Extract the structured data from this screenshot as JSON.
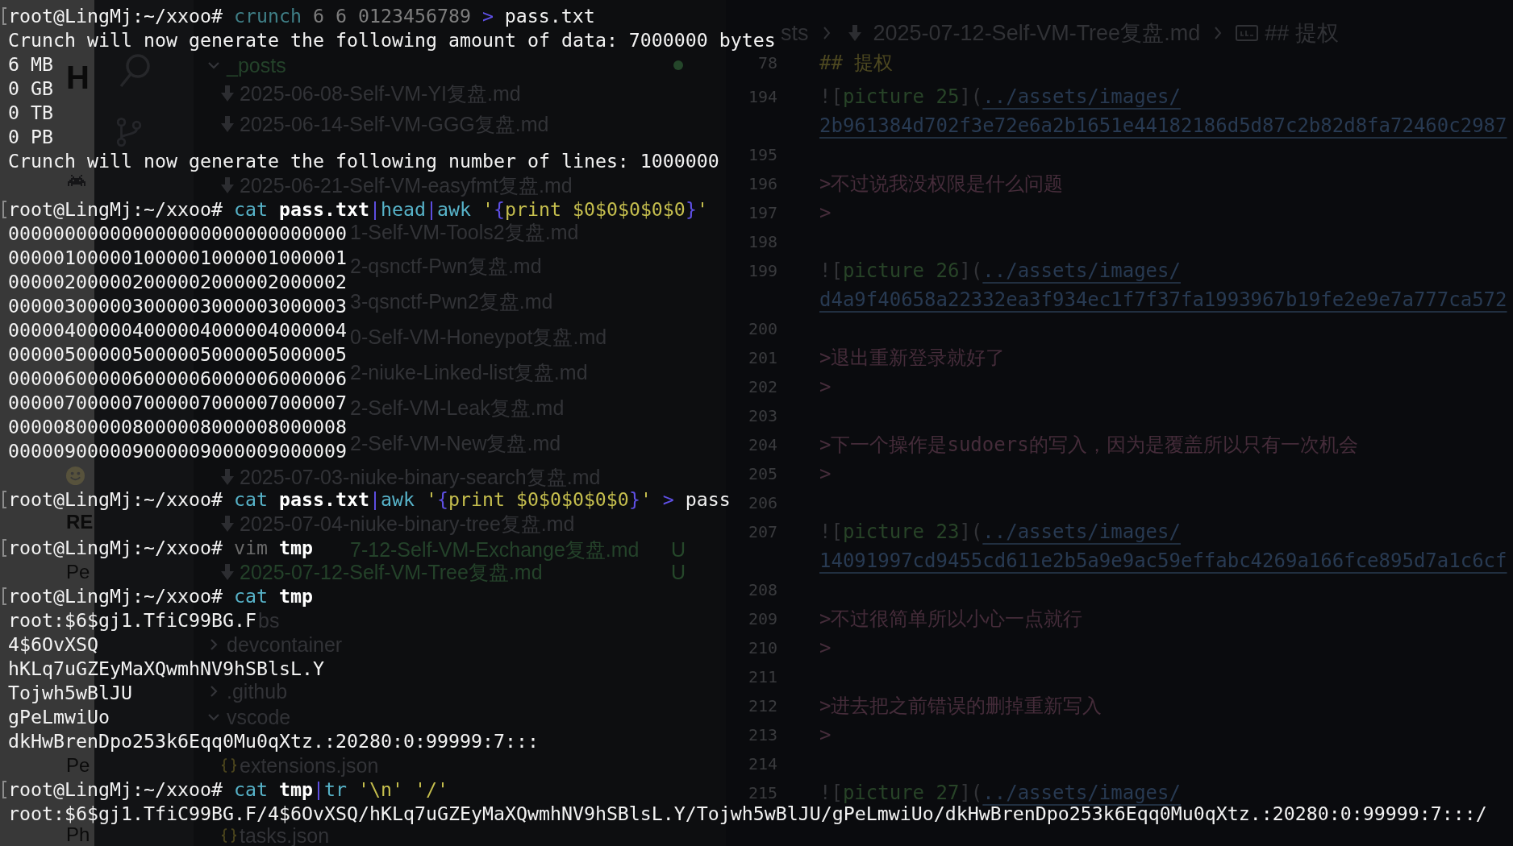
{
  "terminal": {
    "blocks": [
      {
        "prompt": "root@LingMj:~/xxoo#",
        "command": [
          [
            {
              "text": "crunch",
              "kind": "faded"
            }
          ],
          [
            {
              "text": "6",
              "kind": "argument"
            }
          ],
          [
            {
              "text": "6",
              "kind": "argument"
            }
          ],
          [
            {
              "text": "0123456789",
              "kind": "argument"
            }
          ],
          [
            {
              "text": ">",
              "kind": "operator"
            }
          ],
          [
            {
              "text": "pass.txt",
              "kind": "plain"
            }
          ]
        ],
        "output": [
          "Crunch will now generate the following amount of data: 7000000 bytes",
          "6 MB",
          "0 GB",
          "0 TB",
          "0 PB",
          "Crunch will now generate the following number of lines: 1000000"
        ]
      },
      {
        "prompt": "root@LingMj:~/xxoo#",
        "command": [
          [
            {
              "text": "cat",
              "kind": "command"
            }
          ],
          [
            {
              "text": "pass.txt",
              "kind": "file"
            },
            {
              "text": "|",
              "kind": "operator"
            },
            {
              "text": "head",
              "kind": "command"
            },
            {
              "text": "|",
              "kind": "operator"
            },
            {
              "text": "awk",
              "kind": "command"
            }
          ],
          [
            {
              "text": "'",
              "kind": "string"
            },
            {
              "text": "{",
              "kind": "operator"
            },
            {
              "text": "print",
              "kind": "string"
            }
          ],
          [
            {
              "text": "$0$0$0$0$0",
              "kind": "string"
            },
            {
              "text": "}",
              "kind": "operator"
            },
            {
              "text": "'",
              "kind": "string"
            }
          ]
        ],
        "output": [
          "000000000000000000000000000000",
          "000001000001000001000001000001",
          "000002000002000002000002000002",
          "000003000003000003000003000003",
          "000004000004000004000004000004",
          "000005000005000005000005000005",
          "000006000006000006000006000006",
          "000007000007000007000007000007",
          "000008000008000008000008000008",
          "000009000009000009000009000009"
        ]
      },
      {
        "prompt": "root@LingMj:~/xxoo#",
        "command": [
          [
            {
              "text": "cat",
              "kind": "command"
            }
          ],
          [
            {
              "text": "pass.txt",
              "kind": "file"
            },
            {
              "text": "|",
              "kind": "operator"
            },
            {
              "text": "awk",
              "kind": "command"
            }
          ],
          [
            {
              "text": "'",
              "kind": "string"
            },
            {
              "text": "{",
              "kind": "operator"
            },
            {
              "text": "print",
              "kind": "string"
            }
          ],
          [
            {
              "text": "$0$0$0$0$0",
              "kind": "string"
            },
            {
              "text": "}",
              "kind": "operator"
            },
            {
              "text": "'",
              "kind": "string"
            }
          ],
          [
            {
              "text": ">",
              "kind": "operator"
            }
          ],
          [
            {
              "text": "pass",
              "kind": "plain"
            }
          ]
        ]
      },
      {
        "prompt": "root@LingMj:~/xxoo#",
        "command": [
          [
            {
              "text": "vim",
              "kind": "unknown"
            }
          ],
          [
            {
              "text": "tmp",
              "kind": "file"
            }
          ]
        ]
      },
      {
        "prompt": "root@LingMj:~/xxoo#",
        "command": [
          [
            {
              "text": "cat",
              "kind": "command"
            }
          ],
          [
            {
              "text": "tmp",
              "kind": "file"
            }
          ]
        ],
        "output": [
          "root:$6$gj1.TfiC99BG.F",
          "4$6OvXSQ",
          "hKLq7uGZEyMaXQwmhNV9hSBlsL.Y",
          "Tojwh5wBlJU",
          "gPeLmwiUo",
          "dkHwBrenDpo253k6Eqq0Mu0qXtz.:20280:0:99999:7:::"
        ]
      },
      {
        "prompt": "root@LingMj:~/xxoo#",
        "command": [
          [
            {
              "text": "cat",
              "kind": "command"
            }
          ],
          [
            {
              "text": "tmp",
              "kind": "file"
            },
            {
              "text": "|",
              "kind": "operator"
            },
            {
              "text": "tr",
              "kind": "command"
            }
          ],
          [
            {
              "text": "'\\n'",
              "kind": "string"
            }
          ],
          [
            {
              "text": "'/'",
              "kind": "string"
            }
          ]
        ],
        "output": [
          "root:$6$gj1.TfiC99BG.F/4$6OvXSQ/hKLq7uGZEyMaXQwmhNV9hSBlsL.Y/Tojwh5wBlJU/gPeLmwiUo/dkHwBrenDpo253k6Eqq0Mu0qXtz.:20280:0:99999:7:::/"
        ]
      }
    ]
  },
  "background": {
    "side_window": {
      "texts": [
        {
          "text": "H",
          "kind": "title"
        },
        {
          "text": "RE",
          "kind": "heading"
        },
        {
          "text": "Pe",
          "kind": "text"
        },
        {
          "text": "Pe",
          "kind": "text"
        },
        {
          "text": "Ph",
          "kind": "text"
        }
      ]
    },
    "explorer": {
      "tree": [
        {
          "name": "_posts",
          "kind": "folder",
          "expanded": true,
          "modified": true,
          "children": [
            {
              "name": "2025-06-08-Self-VM-YI复盘.md",
              "kind": "markdown"
            },
            {
              "name": "2025-06-14-Self-VM-GGG复盘.md",
              "kind": "markdown"
            },
            {
              "name": "2025-06-21-Self-VM-easyfmt复盘.md",
              "kind": "markdown"
            },
            {
              "name": "1-Self-VM-Tools2复盘.md",
              "kind": "markdown_clipped"
            },
            {
              "name": "2-qsnctf-Pwn复盘.md",
              "kind": "markdown_clipped"
            },
            {
              "name": "3-qsnctf-Pwn2复盘.md",
              "kind": "markdown_clipped"
            },
            {
              "name": "0-Self-VM-Honeypot复盘.md",
              "kind": "markdown_clipped"
            },
            {
              "name": "2-niuke-Linked-list复盘.md",
              "kind": "markdown_clipped"
            },
            {
              "name": "2-Self-VM-Leak复盘.md",
              "kind": "markdown_clipped"
            },
            {
              "name": "2-Self-VM-New复盘.md",
              "kind": "markdown_clipped"
            },
            {
              "name": "2025-07-03-niuke-binary-search复盘.md",
              "kind": "markdown"
            },
            {
              "name": "2025-07-04-niuke-binary-tree复盘.md",
              "kind": "markdown"
            },
            {
              "name": "7-12-Self-VM-Exchange复盘.md",
              "kind": "markdown_clipped",
              "status": "U"
            },
            {
              "name": "2025-07-12-Self-VM-Tree复盘.md",
              "kind": "markdown",
              "status": "U"
            }
          ]
        },
        {
          "name": "bs",
          "kind": "folder_clipped"
        },
        {
          "name": "devcontainer",
          "kind": "folder",
          "expanded": false
        },
        {
          "name": ".github",
          "kind": "folder",
          "expanded": false
        },
        {
          "name": "vscode",
          "kind": "folder",
          "expanded": true,
          "children": [
            {
              "name": "extensions.json",
              "kind": "json"
            },
            {
              "name": "tasks.json",
              "kind": "json"
            }
          ]
        }
      ]
    },
    "editor": {
      "breadcrumb": [
        {
          "text": "sts",
          "kind": "folder"
        },
        {
          "text": "2025-07-12-Self-VM-Tree复盘.md",
          "kind": "markdown"
        },
        {
          "text": "## 提权",
          "kind": "symbol"
        }
      ],
      "sticky_line": {
        "number": "78",
        "segments": [
          {
            "text": "## 提权",
            "kind": "heading"
          }
        ]
      },
      "lines": [
        {
          "number": "194",
          "segments": [
            {
              "text": "![",
              "kind": "punct"
            },
            {
              "text": "picture 25",
              "kind": "alt"
            },
            {
              "text": "](",
              "kind": "punct"
            },
            {
              "text": "../assets/images/",
              "kind": "link"
            }
          ]
        },
        {
          "segments": [
            {
              "text": "2b961384d702f3e72e6a2b1651e44182186d5d87c2b82d8fa72460c2987",
              "kind": "link"
            }
          ]
        },
        {
          "number": "195"
        },
        {
          "number": "196",
          "segments": [
            {
              "text": ">不过说我没权限是什么问题",
              "kind": "quote"
            }
          ]
        },
        {
          "number": "197",
          "segments": [
            {
              "text": ">",
              "kind": "quote"
            }
          ]
        },
        {
          "number": "198"
        },
        {
          "number": "199",
          "segments": [
            {
              "text": "![",
              "kind": "punct"
            },
            {
              "text": "picture 26",
              "kind": "alt"
            },
            {
              "text": "](",
              "kind": "punct"
            },
            {
              "text": "../assets/images/",
              "kind": "link"
            }
          ]
        },
        {
          "segments": [
            {
              "text": "d4a9f40658a22332ea3f934ec1f7f37fa1993967b19fe2e9e7a777ca572",
              "kind": "link"
            }
          ]
        },
        {
          "number": "200"
        },
        {
          "number": "201",
          "segments": [
            {
              "text": ">退出重新登录就好了",
              "kind": "quote"
            }
          ]
        },
        {
          "number": "202",
          "segments": [
            {
              "text": ">",
              "kind": "quote"
            }
          ]
        },
        {
          "number": "203"
        },
        {
          "number": "204",
          "segments": [
            {
              "text": ">下一个操作是sudoers的写入，因为是覆盖所以只有一次机会",
              "kind": "quote"
            }
          ]
        },
        {
          "number": "205",
          "segments": [
            {
              "text": ">",
              "kind": "quote"
            }
          ]
        },
        {
          "number": "206"
        },
        {
          "number": "207",
          "segments": [
            {
              "text": "![",
              "kind": "punct"
            },
            {
              "text": "picture 23",
              "kind": "alt"
            },
            {
              "text": "](",
              "kind": "punct"
            },
            {
              "text": "../assets/images/",
              "kind": "link"
            }
          ]
        },
        {
          "segments": [
            {
              "text": "14091997cd9455cd611e2b5a9e9ac59effabc4269a166fce895d7a1c6cf",
              "kind": "link"
            }
          ]
        },
        {
          "number": "208"
        },
        {
          "number": "209",
          "segments": [
            {
              "text": ">不过很简单所以小心一点就行",
              "kind": "quote"
            }
          ]
        },
        {
          "number": "210",
          "segments": [
            {
              "text": ">",
              "kind": "quote"
            }
          ]
        },
        {
          "number": "211"
        },
        {
          "number": "212",
          "segments": [
            {
              "text": ">进去把之前错误的删掉重新写入",
              "kind": "quote"
            }
          ]
        },
        {
          "number": "213",
          "segments": [
            {
              "text": ">",
              "kind": "quote"
            }
          ]
        },
        {
          "number": "214"
        },
        {
          "number": "215",
          "segments": [
            {
              "text": "![",
              "kind": "punct"
            },
            {
              "text": "picture 27",
              "kind": "alt"
            },
            {
              "text": "](",
              "kind": "punct"
            },
            {
              "text": "../assets/images/",
              "kind": "link"
            }
          ]
        }
      ]
    }
  }
}
